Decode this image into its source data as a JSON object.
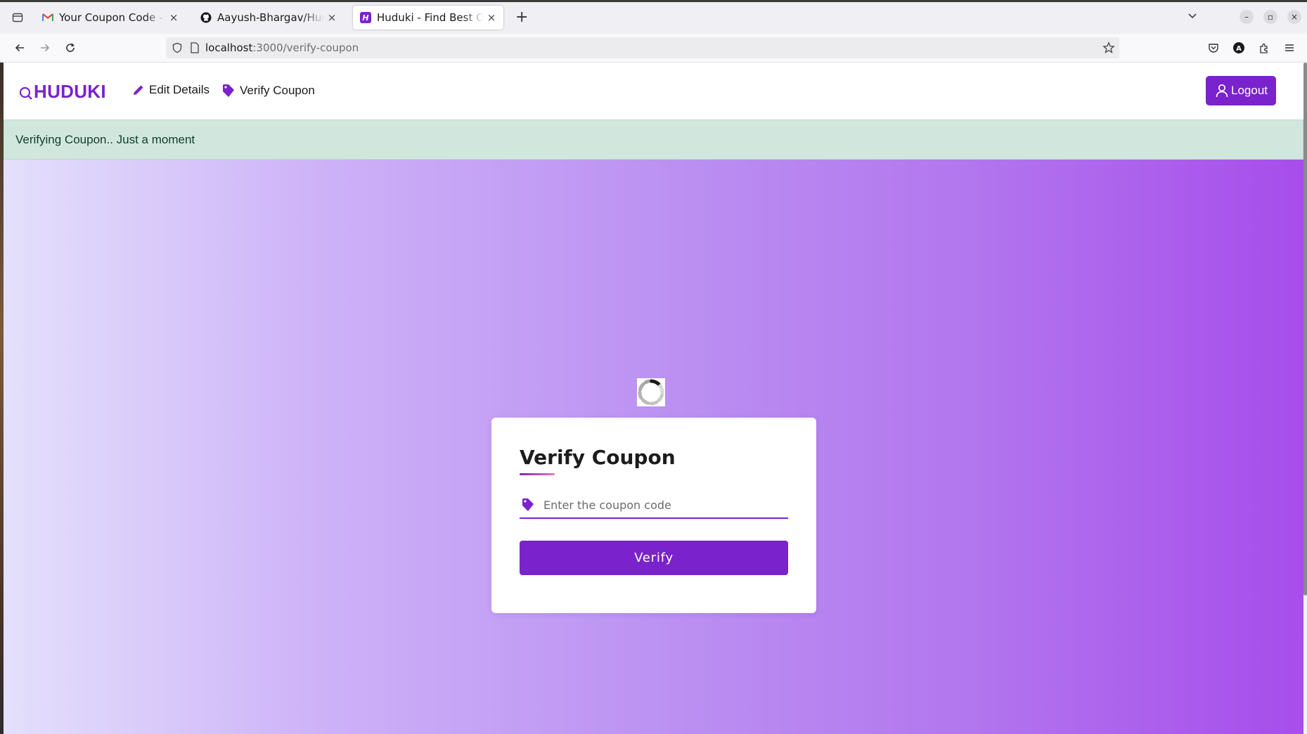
{
  "browser": {
    "tabs": [
      {
        "title": "Your Coupon Code - aayush",
        "favicon": "gmail-icon",
        "active": false
      },
      {
        "title": "Aayush-Bhargav/Huduki-Find",
        "favicon": "github-icon",
        "active": false
      },
      {
        "title": "Huduki - Find Best Offers",
        "favicon": "huduki-icon",
        "active": true
      }
    ],
    "url_host": "localhost",
    "url_path": ":3000/verify-coupon"
  },
  "site": {
    "logo_text": "HUDUKI",
    "nav": {
      "edit_details": "Edit Details",
      "verify_coupon": "Verify Coupon"
    },
    "logout_label": "Logout",
    "alert_text": "Verifying Coupon.. Just a moment"
  },
  "card": {
    "title": "Verify Coupon",
    "input_placeholder": "Enter the coupon code",
    "input_value": "",
    "button_label": "Verify"
  },
  "colors": {
    "brand_purple": "#7a22cc",
    "alert_bg": "#d1e7dd",
    "gradient_start": "#e4e0fc",
    "gradient_end": "#a74deb"
  }
}
